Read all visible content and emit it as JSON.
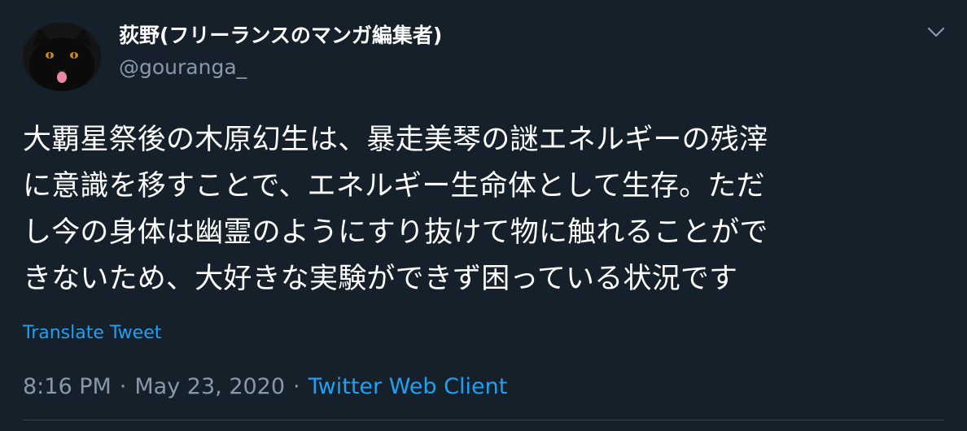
{
  "author": {
    "display_name": "荻野(フリーランスのマンガ編集者)",
    "handle": "@gouranga_",
    "avatar_icon": "black-cat-avatar-icon"
  },
  "menu_icon": "chevron-down-icon",
  "tweet": {
    "lines": [
      "大覇星祭後の木原幻生は、暴走美琴の謎エネルギーの残滓",
      "に意識を移すことで、エネルギー生命体として生存。ただ",
      "し今の身体は幽霊のようにすり抜けて物に触れることがで",
      "きないため、大好きな実験ができず困っている状況です"
    ],
    "translate_label": "Translate Tweet"
  },
  "meta": {
    "time": "8:16 PM",
    "separator1": "·",
    "date": "May 23, 2020",
    "separator2": "·",
    "client": "Twitter Web Client"
  },
  "colors": {
    "background": "#15202b",
    "primary_text": "#ffffff",
    "secondary_text": "#8899a6",
    "link": "#1da1f2",
    "divider": "#38444d"
  }
}
